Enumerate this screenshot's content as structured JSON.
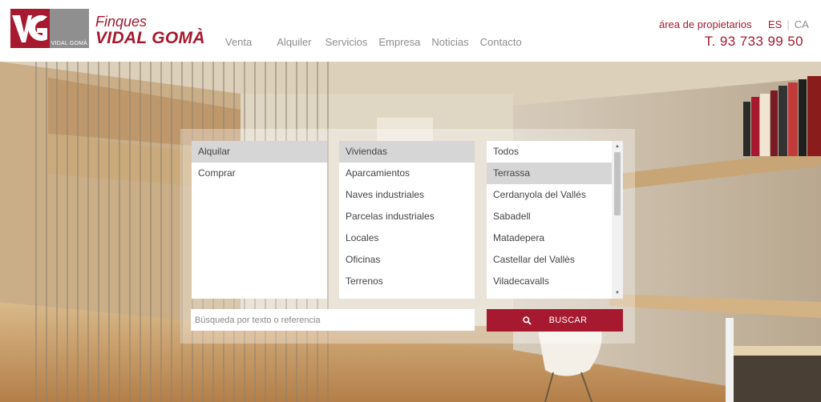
{
  "brand": {
    "mark_text": "VG",
    "mark_caption": "VIDAL GOMÀ",
    "name_top": "Finques",
    "name_bottom": "VIDAL GOMÀ"
  },
  "nav": {
    "items": [
      "Venta",
      "Alquiler",
      "Servicios",
      "Empresa",
      "Noticias",
      "Contacto"
    ]
  },
  "header_right": {
    "owners_link": "área de propietarios",
    "languages": [
      "ES",
      "CA"
    ],
    "language_separator": "|",
    "phone": "T. 93 733 99 50"
  },
  "search": {
    "operations": {
      "selected": "Alquilar",
      "options": [
        "Alquilar",
        "Comprar"
      ]
    },
    "property_types": {
      "selected": "Viviendas",
      "options": [
        "Viviendas",
        "Aparcamientos",
        "Naves industriales",
        "Parcelas industriales",
        "Locales",
        "Oficinas",
        "Terrenos"
      ]
    },
    "cities": {
      "selected": "Terrassa",
      "options": [
        "Todos",
        "Terrassa",
        "Cerdanyola del Vallés",
        "Sabadell",
        "Matadepera",
        "Castellar del Vallès",
        "Viladecavalls"
      ]
    },
    "text_placeholder": "Búsqueda por texto o referencia",
    "text_value": "",
    "button_label": "BUSCAR",
    "button_icon": "search-icon"
  },
  "colors": {
    "brand_red": "#a6192e",
    "logo_grey": "#8f8f8f",
    "nav_grey": "#8d8d8d",
    "selected_option": "#d6d6d6"
  }
}
